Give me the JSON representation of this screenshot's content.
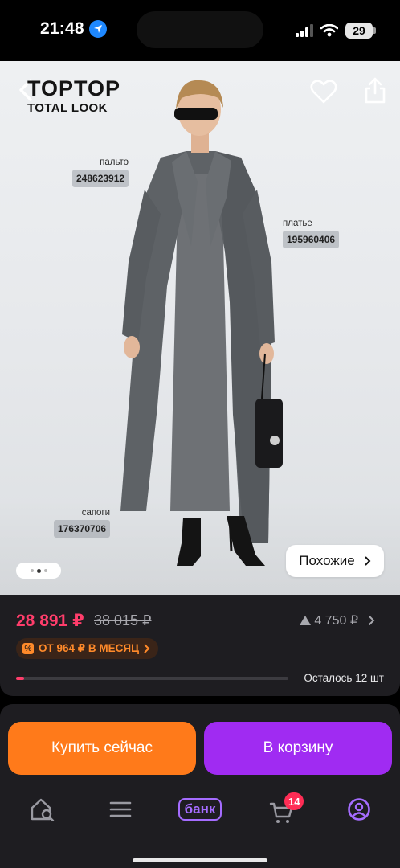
{
  "status_bar": {
    "time": "21:48",
    "battery": "29"
  },
  "header": {
    "brand_line1": "TOPTOP",
    "brand_line2": "TOTAL LOOK"
  },
  "tags": [
    {
      "label": "пальто",
      "sku": "248623912"
    },
    {
      "label": "платье",
      "sku": "195960406"
    },
    {
      "label": "сапоги",
      "sku": "176370706"
    }
  ],
  "gallery": {
    "dots_total": 3,
    "active_dot": 2,
    "similar_label": "Похожие"
  },
  "price": {
    "current": "28 891 ₽",
    "old": "38 015 ₽",
    "points": "4 750 ₽",
    "installment": "ОТ 964 ₽ В МЕСЯЦ",
    "stock_text": "Осталось 12 шт",
    "stock_fill_fraction": 0.03
  },
  "actions": {
    "buy_now": "Купить сейчас",
    "add_to_cart": "В корзину"
  },
  "tabbar": {
    "bank_label": "банк",
    "cart_count": "14"
  },
  "colors": {
    "accent_pink": "#ff3d6b",
    "buy_orange": "#ff7a1a",
    "cart_purple": "#a02bf2",
    "installment_orange": "#ff8a2a"
  }
}
